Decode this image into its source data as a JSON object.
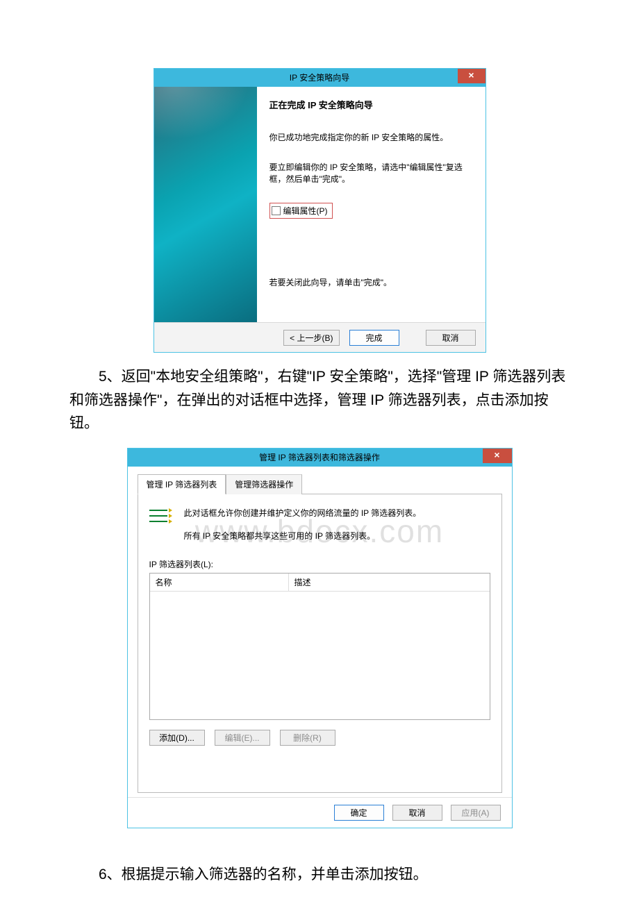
{
  "wizard1": {
    "title": "IP 安全策略向导",
    "close": "×",
    "heading": "正在完成 IP 安全策略向导",
    "line1": "你已成功地完成指定你的新 IP 安全策略的属性。",
    "line2": "要立即编辑你的 IP 安全策略，请选中\"编辑属性\"复选框，然后单击\"完成\"。",
    "checkbox_label": "编辑属性(P)",
    "line3": "若要关闭此向导，请单击\"完成\"。",
    "buttons": {
      "back": "< 上一步(B)",
      "finish": "完成",
      "cancel": "取消"
    }
  },
  "paragraph5": "5、返回\"本地安全组策略\"，右键\"IP 安全策略\"，选择\"管理 IP 筛选器列表和筛选器操作\"，在弹出的对话框中选择，管理 IP 筛选器列表，点击添加按钮。",
  "watermark": "www.bdocx.com",
  "dialog2": {
    "title": "管理 IP 筛选器列表和筛选器操作",
    "close": "×",
    "tabs": {
      "list": "管理 IP 筛选器列表",
      "ops": "管理筛选器操作"
    },
    "desc1": "此对话框允许你创建并维护定义你的网络流量的 IP 筛选器列表。",
    "desc2": "所有 IP 安全策略都共享这些可用的 IP 筛选器列表。",
    "list_label": "IP 筛选器列表(L):",
    "cols": {
      "name": "名称",
      "desc": "描述"
    },
    "buttons": {
      "add": "添加(D)...",
      "edit": "编辑(E)...",
      "remove": "删除(R)",
      "ok": "确定",
      "cancel": "取消",
      "apply": "应用(A)"
    }
  },
  "paragraph6": "6、根据提示输入筛选器的名称，并单击添加按钮。"
}
